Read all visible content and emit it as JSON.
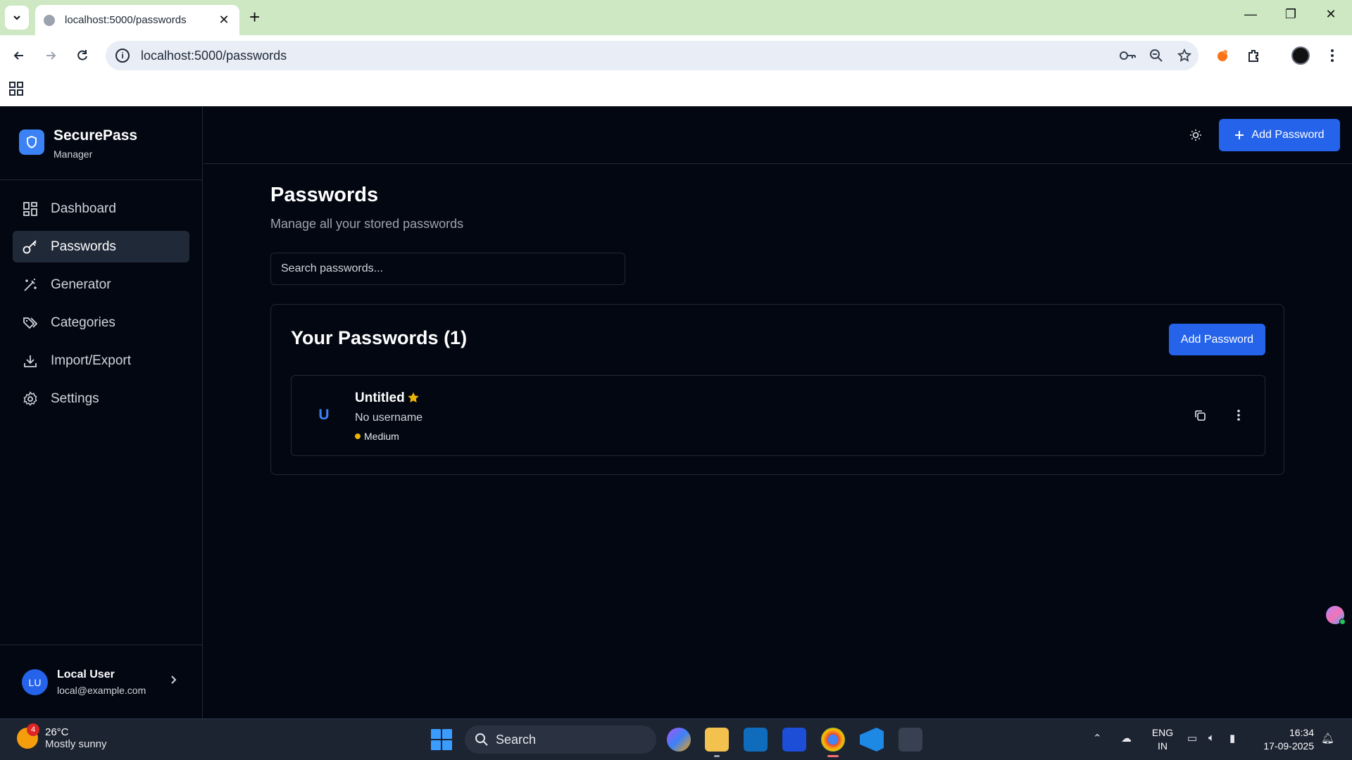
{
  "browser": {
    "tab_title": "localhost:5000/passwords",
    "url": "localhost:5000/passwords"
  },
  "app": {
    "brand_name": "SecurePass",
    "brand_sub": "Manager",
    "nav": [
      {
        "label": "Dashboard",
        "icon": "dashboard-icon",
        "active": false
      },
      {
        "label": "Passwords",
        "icon": "key-icon",
        "active": true
      },
      {
        "label": "Generator",
        "icon": "wand-icon",
        "active": false
      },
      {
        "label": "Categories",
        "icon": "tags-icon",
        "active": false
      },
      {
        "label": "Import/Export",
        "icon": "download-icon",
        "active": false
      },
      {
        "label": "Settings",
        "icon": "gear-icon",
        "active": false
      }
    ],
    "user": {
      "initials": "LU",
      "name": "Local User",
      "email": "local@example.com"
    },
    "header_add_label": "Add Password",
    "page_title": "Passwords",
    "page_subtitle": "Manage all your stored passwords",
    "search_placeholder": "Search passwords...",
    "card_title": "Your Passwords (1)",
    "card_add_label": "Add Password",
    "entries": [
      {
        "initial": "U",
        "name": "Untitled",
        "favorite": true,
        "username": "No username",
        "strength": "Medium",
        "strength_color": "#eab308"
      }
    ],
    "accent": "#2563eb"
  },
  "taskbar": {
    "weather_badge": "4",
    "weather_temp": "26°C",
    "weather_desc": "Mostly sunny",
    "search_label": "Search",
    "lang_line1": "ENG",
    "lang_line2": "IN",
    "time": "16:34",
    "date": "17-09-2025"
  }
}
